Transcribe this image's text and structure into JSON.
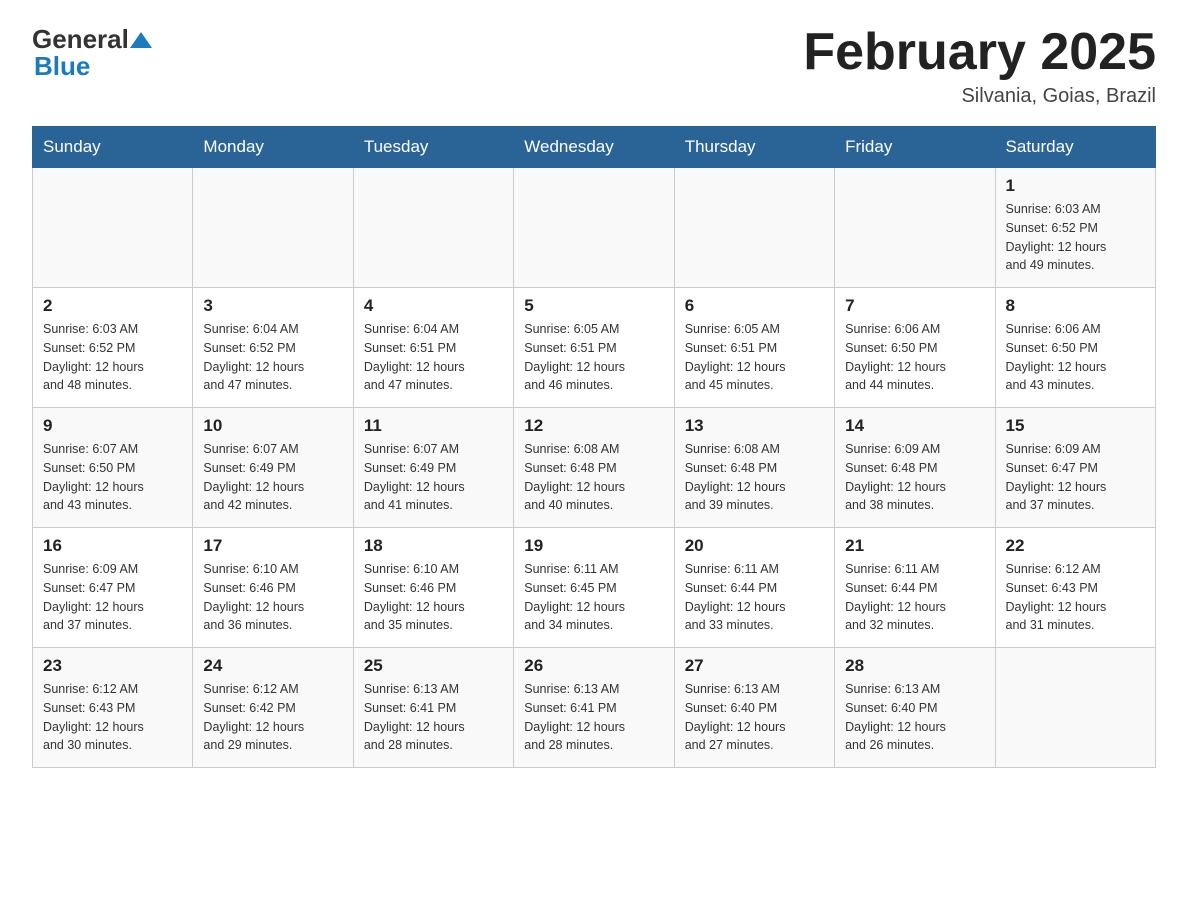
{
  "header": {
    "logo_general": "General",
    "logo_blue": "Blue",
    "month_title": "February 2025",
    "subtitle": "Silvania, Goias, Brazil"
  },
  "days_of_week": [
    "Sunday",
    "Monday",
    "Tuesday",
    "Wednesday",
    "Thursday",
    "Friday",
    "Saturday"
  ],
  "weeks": [
    {
      "days": [
        {
          "num": "",
          "info": ""
        },
        {
          "num": "",
          "info": ""
        },
        {
          "num": "",
          "info": ""
        },
        {
          "num": "",
          "info": ""
        },
        {
          "num": "",
          "info": ""
        },
        {
          "num": "",
          "info": ""
        },
        {
          "num": "1",
          "info": "Sunrise: 6:03 AM\nSunset: 6:52 PM\nDaylight: 12 hours\nand 49 minutes."
        }
      ]
    },
    {
      "days": [
        {
          "num": "2",
          "info": "Sunrise: 6:03 AM\nSunset: 6:52 PM\nDaylight: 12 hours\nand 48 minutes."
        },
        {
          "num": "3",
          "info": "Sunrise: 6:04 AM\nSunset: 6:52 PM\nDaylight: 12 hours\nand 47 minutes."
        },
        {
          "num": "4",
          "info": "Sunrise: 6:04 AM\nSunset: 6:51 PM\nDaylight: 12 hours\nand 47 minutes."
        },
        {
          "num": "5",
          "info": "Sunrise: 6:05 AM\nSunset: 6:51 PM\nDaylight: 12 hours\nand 46 minutes."
        },
        {
          "num": "6",
          "info": "Sunrise: 6:05 AM\nSunset: 6:51 PM\nDaylight: 12 hours\nand 45 minutes."
        },
        {
          "num": "7",
          "info": "Sunrise: 6:06 AM\nSunset: 6:50 PM\nDaylight: 12 hours\nand 44 minutes."
        },
        {
          "num": "8",
          "info": "Sunrise: 6:06 AM\nSunset: 6:50 PM\nDaylight: 12 hours\nand 43 minutes."
        }
      ]
    },
    {
      "days": [
        {
          "num": "9",
          "info": "Sunrise: 6:07 AM\nSunset: 6:50 PM\nDaylight: 12 hours\nand 43 minutes."
        },
        {
          "num": "10",
          "info": "Sunrise: 6:07 AM\nSunset: 6:49 PM\nDaylight: 12 hours\nand 42 minutes."
        },
        {
          "num": "11",
          "info": "Sunrise: 6:07 AM\nSunset: 6:49 PM\nDaylight: 12 hours\nand 41 minutes."
        },
        {
          "num": "12",
          "info": "Sunrise: 6:08 AM\nSunset: 6:48 PM\nDaylight: 12 hours\nand 40 minutes."
        },
        {
          "num": "13",
          "info": "Sunrise: 6:08 AM\nSunset: 6:48 PM\nDaylight: 12 hours\nand 39 minutes."
        },
        {
          "num": "14",
          "info": "Sunrise: 6:09 AM\nSunset: 6:48 PM\nDaylight: 12 hours\nand 38 minutes."
        },
        {
          "num": "15",
          "info": "Sunrise: 6:09 AM\nSunset: 6:47 PM\nDaylight: 12 hours\nand 37 minutes."
        }
      ]
    },
    {
      "days": [
        {
          "num": "16",
          "info": "Sunrise: 6:09 AM\nSunset: 6:47 PM\nDaylight: 12 hours\nand 37 minutes."
        },
        {
          "num": "17",
          "info": "Sunrise: 6:10 AM\nSunset: 6:46 PM\nDaylight: 12 hours\nand 36 minutes."
        },
        {
          "num": "18",
          "info": "Sunrise: 6:10 AM\nSunset: 6:46 PM\nDaylight: 12 hours\nand 35 minutes."
        },
        {
          "num": "19",
          "info": "Sunrise: 6:11 AM\nSunset: 6:45 PM\nDaylight: 12 hours\nand 34 minutes."
        },
        {
          "num": "20",
          "info": "Sunrise: 6:11 AM\nSunset: 6:44 PM\nDaylight: 12 hours\nand 33 minutes."
        },
        {
          "num": "21",
          "info": "Sunrise: 6:11 AM\nSunset: 6:44 PM\nDaylight: 12 hours\nand 32 minutes."
        },
        {
          "num": "22",
          "info": "Sunrise: 6:12 AM\nSunset: 6:43 PM\nDaylight: 12 hours\nand 31 minutes."
        }
      ]
    },
    {
      "days": [
        {
          "num": "23",
          "info": "Sunrise: 6:12 AM\nSunset: 6:43 PM\nDaylight: 12 hours\nand 30 minutes."
        },
        {
          "num": "24",
          "info": "Sunrise: 6:12 AM\nSunset: 6:42 PM\nDaylight: 12 hours\nand 29 minutes."
        },
        {
          "num": "25",
          "info": "Sunrise: 6:13 AM\nSunset: 6:41 PM\nDaylight: 12 hours\nand 28 minutes."
        },
        {
          "num": "26",
          "info": "Sunrise: 6:13 AM\nSunset: 6:41 PM\nDaylight: 12 hours\nand 28 minutes."
        },
        {
          "num": "27",
          "info": "Sunrise: 6:13 AM\nSunset: 6:40 PM\nDaylight: 12 hours\nand 27 minutes."
        },
        {
          "num": "28",
          "info": "Sunrise: 6:13 AM\nSunset: 6:40 PM\nDaylight: 12 hours\nand 26 minutes."
        },
        {
          "num": "",
          "info": ""
        }
      ]
    }
  ]
}
